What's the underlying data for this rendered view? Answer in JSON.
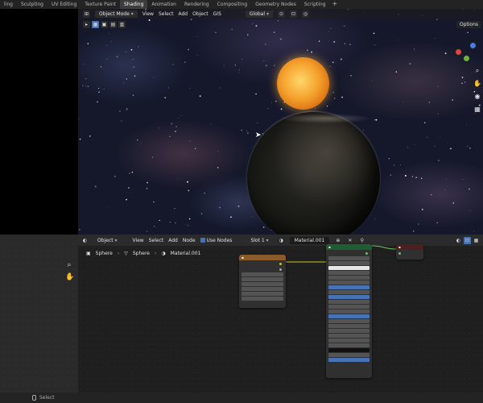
{
  "workspace_tabs": [
    {
      "label": "ling",
      "active": false
    },
    {
      "label": "Sculpting",
      "active": false
    },
    {
      "label": "UV Editing",
      "active": false
    },
    {
      "label": "Texture Paint",
      "active": false
    },
    {
      "label": "Shading",
      "active": true
    },
    {
      "label": "Animation",
      "active": false
    },
    {
      "label": "Rendering",
      "active": false
    },
    {
      "label": "Compositing",
      "active": false
    },
    {
      "label": "Geometry Nodes",
      "active": false
    },
    {
      "label": "Scripting",
      "active": false
    }
  ],
  "add_tab_label": "+",
  "viewport": {
    "mode_label": "Object Mode",
    "menus": [
      "View",
      "Select",
      "Add",
      "Object",
      "GIS"
    ],
    "orientation_label": "Global",
    "options_label": "Options"
  },
  "node_editor": {
    "type_label": "Object",
    "menus": [
      "View",
      "Select",
      "Add",
      "Node"
    ],
    "use_nodes_label": "Use Nodes",
    "slot_label": "Slot 1",
    "material_label": "Material.001",
    "breadcrumb": [
      "Sphere",
      "Sphere",
      "Material.001"
    ]
  },
  "status_bar": {
    "select_label": "Select"
  },
  "colors": {
    "accent": "#4772b3",
    "active_tab": "#3d3d3d",
    "sun": "#f5a12c",
    "image_texture_header": "#8a5a2b",
    "bsdf_header": "#1f5d33",
    "output_header": "#4d1f1f"
  },
  "icons": [
    "search-icon",
    "hand-icon",
    "camera-icon",
    "grid-icon",
    "cursor-icon"
  ]
}
